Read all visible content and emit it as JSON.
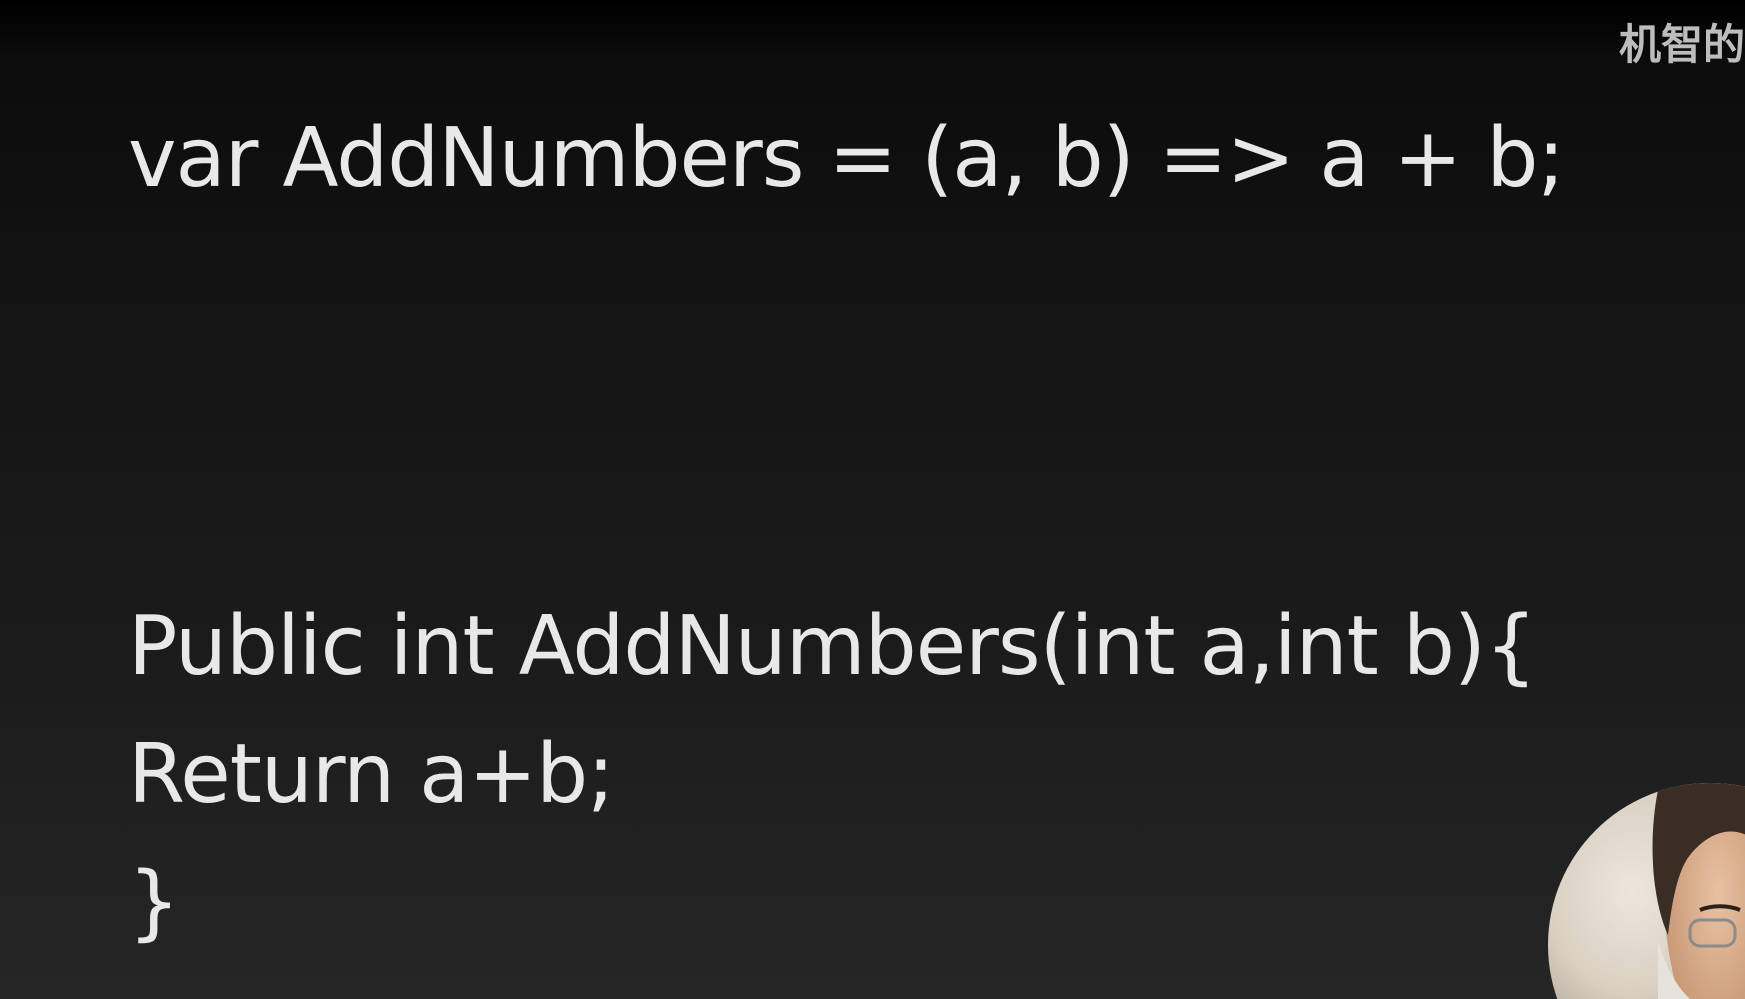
{
  "slide": {
    "code_lambda": "var AddNumbers = (a, b) => a + b;",
    "code_method_signature": "Public int AddNumbers(int a,int b){",
    "code_method_body": "Return a+b;",
    "code_method_close": "}"
  },
  "watermark": {
    "text": "机智的"
  },
  "colors": {
    "background_top": "#000000",
    "background_bottom": "#262626",
    "code_text": "#e8e8e8",
    "watermark_text": "#bdbdbd"
  }
}
